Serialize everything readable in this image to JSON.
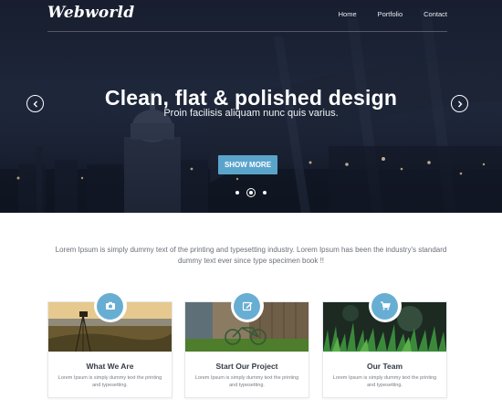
{
  "brand": {
    "logo": "Webworld",
    "accent": "#5aa4cc"
  },
  "nav": {
    "items": [
      "Home",
      "Portfolio",
      "Contact"
    ]
  },
  "hero": {
    "title": "Clean, flat & polished design",
    "subtitle": "Proin facilisis aliquam nunc quis varius.",
    "button": "SHOW MORE",
    "slides": 3,
    "active_slide": 2
  },
  "intro": {
    "text": "Lorem Ipsum is simply dummy text of the printing and typesetting industry. Lorem Ipsum has been the industry's standard dummy text ever since type specimen book !!"
  },
  "cards": [
    {
      "icon": "camera-icon",
      "title": "What We Are",
      "text": "Lorem Ipsum is simply dummy text the printing and typesetting."
    },
    {
      "icon": "edit-icon",
      "title": "Start Our Project",
      "text": "Lorem Ipsum is simply dummy text the printing and typesetting."
    },
    {
      "icon": "cart-icon",
      "title": "Our Team",
      "text": "Lorem Ipsum is simply dummy text the printing and typesetting."
    }
  ]
}
